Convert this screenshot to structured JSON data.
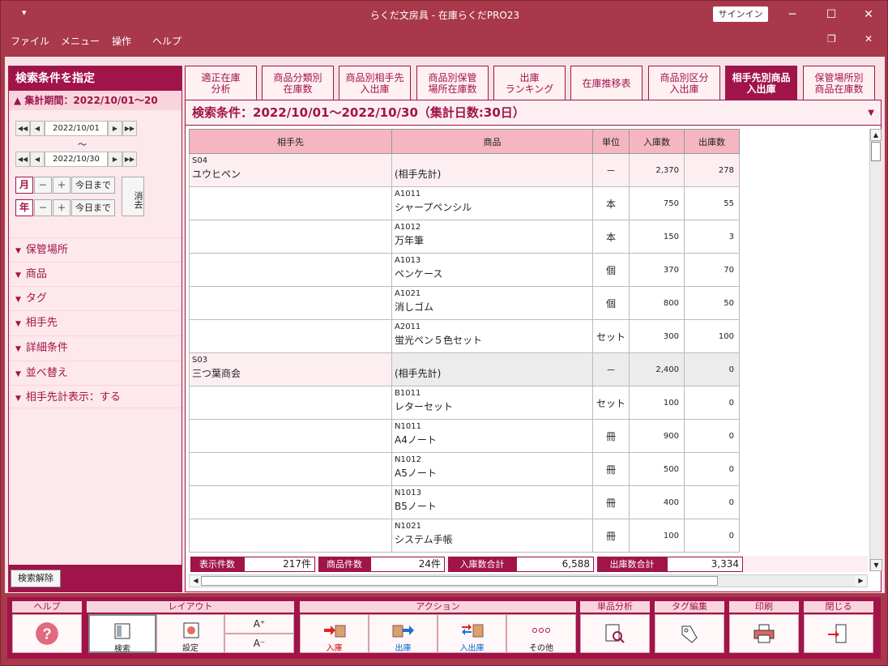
{
  "titlebar": {
    "quick": "▾",
    "title": "らくだ文房具 - 在庫らくだPRO23",
    "signin": "サインイン"
  },
  "menu": [
    "ファイル",
    "メニュー",
    "操作",
    "ヘルプ"
  ],
  "side": {
    "header": "検索条件を指定",
    "period_label": "▲ 集計期間：2022/10/01〜20",
    "date_from": "2022/10/01",
    "date_to": "2022/10/30",
    "tilde": "～",
    "month": "月",
    "year": "年",
    "minus": "－",
    "plus": "＋",
    "today": "今日まで",
    "clear": "消去",
    "sections": [
      "保管場所",
      "商品",
      "タグ",
      "相手先",
      "詳細条件",
      "並べ替え",
      "相手先計表示：する"
    ],
    "reset": "検索解除"
  },
  "tabs": [
    [
      "適正在庫",
      "分析"
    ],
    [
      "商品分類別",
      "在庫数"
    ],
    [
      "商品別相手先",
      "入出庫"
    ],
    [
      "商品別保管",
      "場所在庫数"
    ],
    [
      "出庫",
      "ランキング"
    ],
    [
      "在庫推移表",
      ""
    ],
    [
      "商品別区分",
      "入出庫"
    ],
    [
      "相手先別商品",
      "入出庫"
    ],
    [
      "保管場所別",
      "商品在庫数"
    ]
  ],
  "active_tab": 7,
  "condition": "検索条件：2022/10/01〜2022/10/30（集計日数:30日）",
  "columns": [
    "相手先",
    "商品",
    "単位",
    "入庫数",
    "出庫数"
  ],
  "groups": [
    {
      "code": "S04",
      "name": "ユウヒペン",
      "total": {
        "label": "(相手先計)",
        "unit": "－",
        "in": "2,370",
        "out": "278"
      },
      "rows": [
        [
          "A1011",
          "シャープペンシル",
          "本",
          "750",
          "55"
        ],
        [
          "A1012",
          "万年筆",
          "本",
          "150",
          "3"
        ],
        [
          "A1013",
          "ペンケース",
          "個",
          "370",
          "70"
        ],
        [
          "A1021",
          "消しゴム",
          "個",
          "800",
          "50"
        ],
        [
          "A2011",
          "蛍光ペン５色セット",
          "セット",
          "300",
          "100"
        ]
      ]
    },
    {
      "code": "S03",
      "name": "三つ葉商会",
      "total": {
        "label": "(相手先計)",
        "unit": "－",
        "in": "2,400",
        "out": "0"
      },
      "rows": [
        [
          "B1011",
          "レターセット",
          "セット",
          "100",
          "0"
        ],
        [
          "N1011",
          "A4ノート",
          "冊",
          "900",
          "0"
        ],
        [
          "N1012",
          "A5ノート",
          "冊",
          "500",
          "0"
        ],
        [
          "N1013",
          "B5ノート",
          "冊",
          "400",
          "0"
        ],
        [
          "N1021",
          "システム手帳",
          "冊",
          "100",
          "0"
        ]
      ]
    }
  ],
  "totals": {
    "count_label": "表示件数",
    "count": "217件",
    "items_label": "商品件数",
    "items": "24件",
    "in_label": "入庫数合計",
    "in": "6,588",
    "out_label": "出庫数合計",
    "out": "3,334"
  },
  "toolbar": {
    "help": "ヘルプ",
    "layout": "レイアウト",
    "action": "アクション",
    "analysis": "単品分析",
    "tag": "タグ編集",
    "print": "印刷",
    "close": "閉じる",
    "search": "検索",
    "settings": "設定",
    "font_up": "A⁺",
    "font_down": "A⁻",
    "in": "入庫",
    "out": "出庫",
    "inout": "入出庫",
    "other": "その他"
  }
}
